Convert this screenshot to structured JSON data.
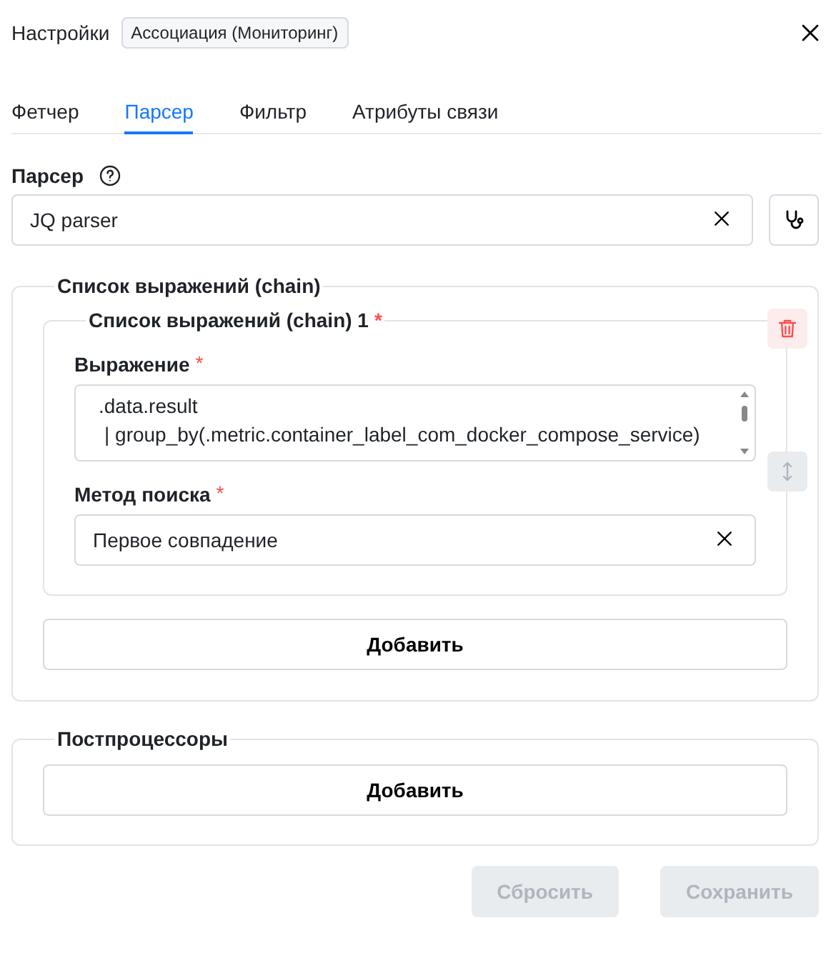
{
  "header": {
    "title": "Настройки",
    "badge": "Ассоциация (Мониторинг)"
  },
  "tabs": [
    {
      "label": "Фетчер",
      "selected": false
    },
    {
      "label": "Парсер",
      "selected": true
    },
    {
      "label": "Фильтр",
      "selected": false
    },
    {
      "label": "Атрибуты связи",
      "selected": false
    }
  ],
  "parser": {
    "label": "Парсер",
    "value": "JQ parser"
  },
  "chain": {
    "legend": "Список выражений (chain)",
    "items": [
      {
        "legend": "Список выражений (chain) 1",
        "required_mark": "*",
        "fields": [
          {
            "kind": "code",
            "label": "Выражение",
            "required_mark": "*",
            "lines": [
              ".data.result",
              "| group_by(.metric.container_label_com_docker_compose_service)"
            ]
          },
          {
            "kind": "select",
            "label": "Метод поиска",
            "required_mark": "*",
            "value": "Первое совпадение"
          }
        ]
      }
    ],
    "add_button": "Добавить"
  },
  "postprocessors": {
    "legend": "Постпроцессоры",
    "add_button": "Добавить"
  },
  "footer": [
    {
      "label": "Сбросить",
      "disabled": true
    },
    {
      "label": "Сохранить",
      "disabled": true
    }
  ]
}
